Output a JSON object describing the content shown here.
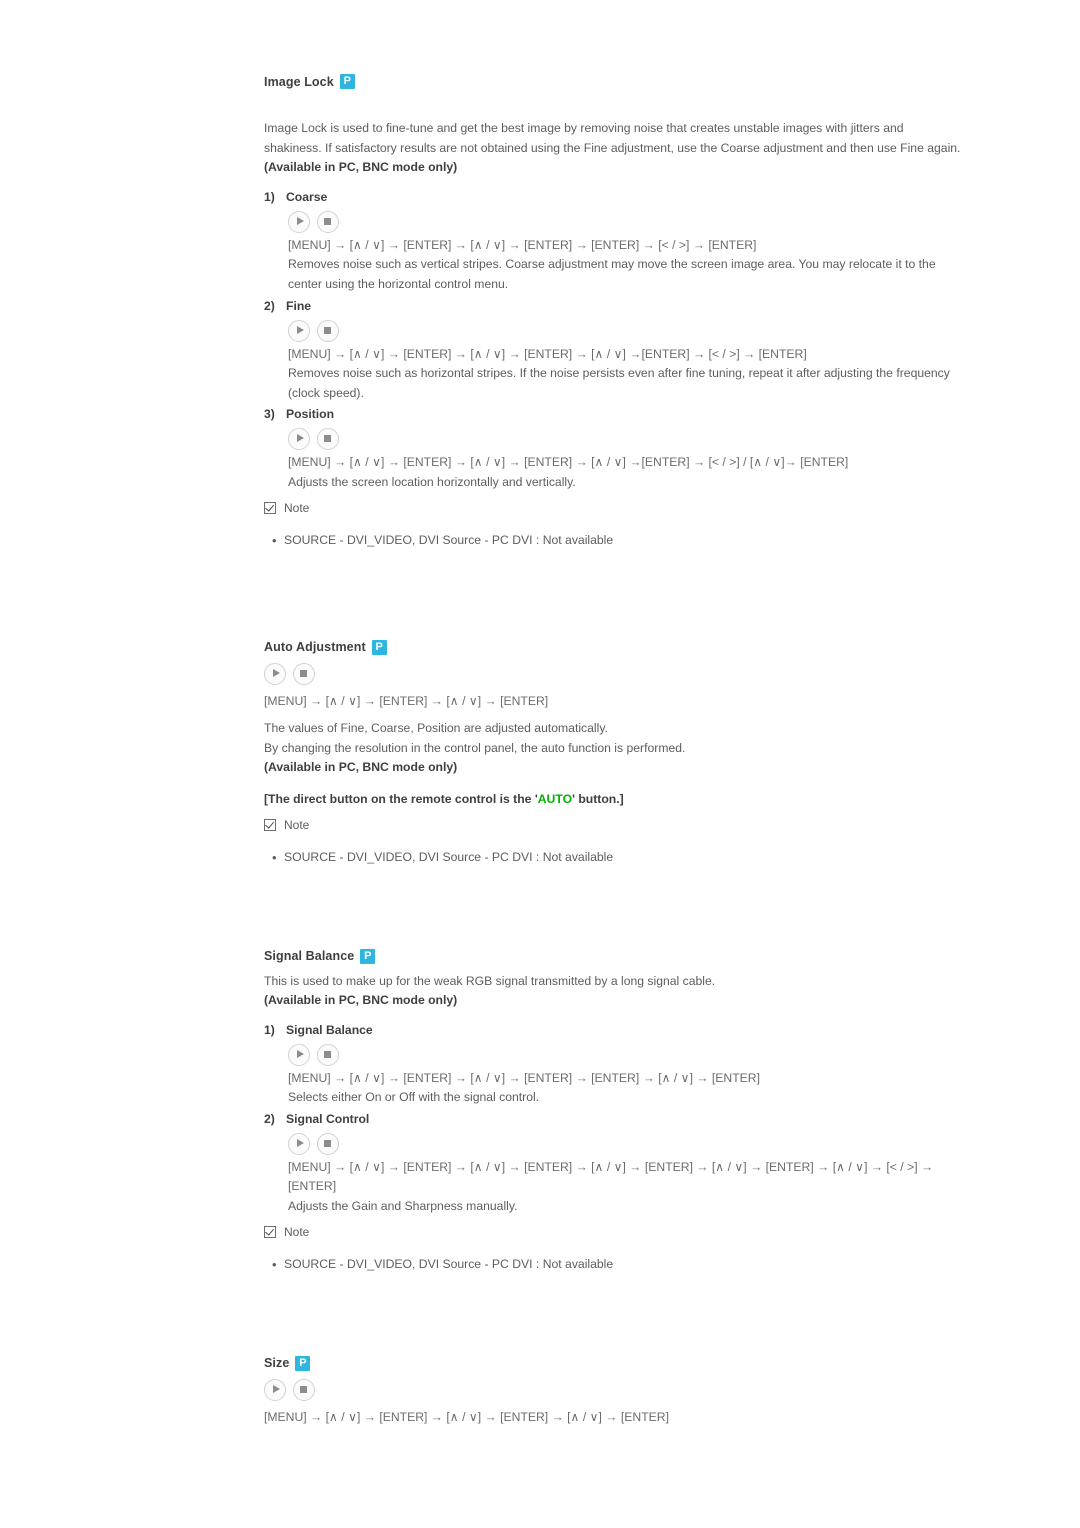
{
  "meta": {
    "badge_letter": "P",
    "badge_color": "#2fb6e0",
    "accent_green": "#00b400",
    "text_color": "#5d5d5d",
    "heading_color": "#3f3f3f"
  },
  "icons": {
    "play": "play-icon",
    "stop": "stop-icon",
    "note_check": "checked-checkbox-icon",
    "bullet": "•"
  },
  "sections": [
    {
      "title": "Image Lock",
      "intro": "Image Lock is used to fine-tune and get the best image by removing noise that creates unstable images with jitters and shakiness. If satisfactory results are not obtained using the Fine adjustment, use the Coarse adjustment and then use Fine again.",
      "availability": "(Available in PC, BNC mode only)",
      "items": [
        {
          "num": "1)",
          "label": "Coarse",
          "sequence": "[MENU] → [∧ / ∨] → [ENTER] → [∧ / ∨] → [ENTER] → [ENTER] → [< / >] → [ENTER]",
          "description": "Removes noise such as vertical stripes. Coarse adjustment may move the screen image area. You may relocate it to the center using the horizontal control menu."
        },
        {
          "num": "2)",
          "label": "Fine",
          "sequence": "[MENU] → [∧ / ∨] → [ENTER] → [∧ / ∨] → [ENTER] → [∧ / ∨] →[ENTER] → [< / >] → [ENTER]",
          "description": "Removes noise such as horizontal stripes. If the noise persists even after fine tuning, repeat it after adjusting the frequency (clock speed)."
        },
        {
          "num": "3)",
          "label": "Position",
          "sequence": "[MENU] → [∧ / ∨] → [ENTER] → [∧ / ∨] → [ENTER] → [∧ / ∨] →[ENTER] → [< / >] / [∧ / ∨]→ [ENTER]",
          "description": "Adjusts the screen location horizontally and vertically."
        }
      ],
      "note_label": "Note",
      "note_bullets": [
        "SOURCE - DVI_VIDEO, DVI Source - PC DVI : Not available"
      ]
    },
    {
      "title": "Auto Adjustment",
      "sequence": "[MENU] → [∧ / ∨] → [ENTER] → [∧ / ∨] → [ENTER]",
      "lines": [
        "The values of Fine, Coarse, Position are adjusted automatically.",
        "By changing the resolution in the control panel, the auto function is performed."
      ],
      "availability": "(Available in PC, BNC mode only)",
      "remote_note_prefix": "[The direct button on the remote control is the '",
      "remote_note_highlight": "AUTO",
      "remote_note_suffix": "' button.]",
      "note_label": "Note",
      "note_bullets": [
        "SOURCE - DVI_VIDEO, DVI Source - PC DVI : Not available"
      ]
    },
    {
      "title": "Signal Balance",
      "intro": "This is used to make up for the weak RGB signal transmitted by a long signal cable.",
      "availability": "(Available in PC, BNC mode only)",
      "items": [
        {
          "num": "1)",
          "label": "Signal Balance",
          "sequence": "[MENU] → [∧ / ∨] → [ENTER] → [∧ / ∨] → [ENTER] → [ENTER] → [∧ / ∨] → [ENTER]",
          "description": "Selects either On or Off with the signal control."
        },
        {
          "num": "2)",
          "label": "Signal Control",
          "sequence": "[MENU] → [∧ / ∨] → [ENTER] → [∧ / ∨] → [ENTER] → [∧ / ∨] → [ENTER] → [∧ / ∨] → [ENTER] → [∧ / ∨] → [< / >] → [ENTER]",
          "description": "Adjusts the Gain and Sharpness manually."
        }
      ],
      "note_label": "Note",
      "note_bullets": [
        "SOURCE - DVI_VIDEO, DVI Source - PC DVI : Not available"
      ]
    },
    {
      "title": "Size",
      "sequence": "[MENU] → [∧ / ∨] → [ENTER] → [∧ / ∨] → [ENTER] → [∧ / ∨] → [ENTER]"
    }
  ]
}
